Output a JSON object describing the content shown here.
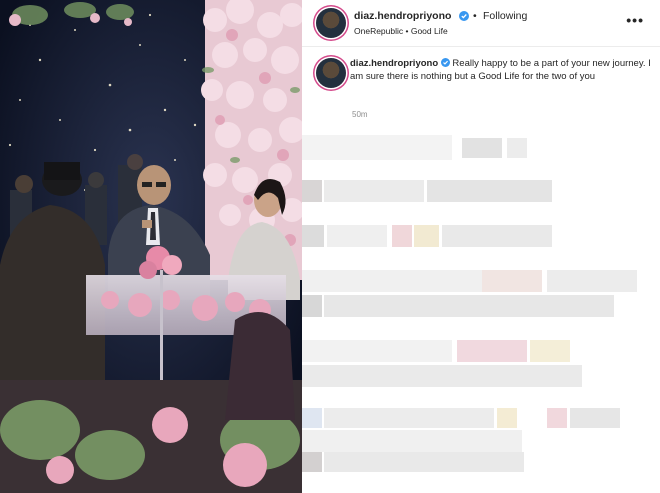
{
  "post": {
    "username": "diaz.hendropriyono",
    "separator": "•",
    "follow_status": "Following",
    "music": "OneRepublic • Good Life",
    "more_icon": "more-horizontal-icon",
    "verified_icon": "verified-badge-icon"
  },
  "caption": {
    "username": "diaz.hendropriyono",
    "text": "Really happy to be a part of your new journey. I am sure there is nothing but a Good Life for the two of you",
    "timestamp": "50m"
  },
  "colors": {
    "verified": "#3897f0",
    "text": "#262626",
    "muted": "#8e8e8e",
    "story_ring": "#d44a8b"
  }
}
